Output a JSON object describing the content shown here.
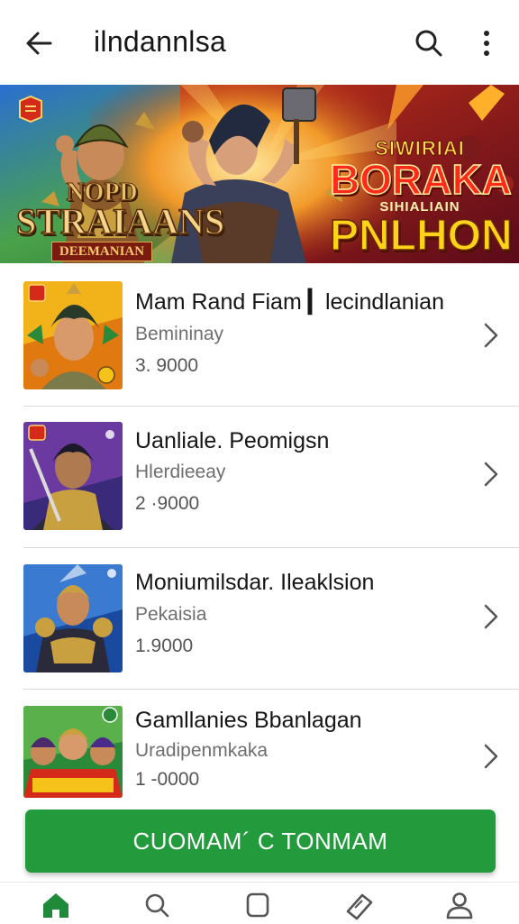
{
  "app_bar": {
    "title": "ilndannlsa",
    "back_icon": "arrow-left-icon",
    "search_icon": "search-icon",
    "more_icon": "more-vertical-icon"
  },
  "banner": {
    "left_title_top": "NOPD",
    "left_title_main": "STRAIAANS",
    "left_ribbon": "DEEMANIAN",
    "right_small_top": "SIWIRIAI",
    "right_title_main": "BORAKA",
    "right_small_mid": "SIHIALIAIN",
    "right_title_bottom": "PNLHON"
  },
  "games": [
    {
      "name": "Mam Rand Fiam ▎lecindlanian",
      "subtitle": "Bemininay",
      "count": "3. 9000",
      "chevron_icon": "chevron-right-icon"
    },
    {
      "name": "Uanliale. Peomigsn",
      "subtitle": "Hlerdieeay",
      "count": "2 ·9000",
      "chevron_icon": "chevron-right-icon"
    },
    {
      "name": "Moniumilsdar. Ileaklsion",
      "subtitle": "Pekaisia",
      "count": "1.9000",
      "chevron_icon": "chevron-right-icon"
    },
    {
      "name": "Gamllanies Bbanlagan",
      "subtitle": "Uradipenmkaka",
      "count": "1 -0000",
      "chevron_icon": "chevron-right-icon"
    }
  ],
  "cta": {
    "label": "CUOMAM´ C TONMAM"
  },
  "bottom_nav": [
    {
      "icon": "home-icon",
      "active": true
    },
    {
      "icon": "search-icon",
      "active": false
    },
    {
      "icon": "square-icon",
      "active": false
    },
    {
      "icon": "ticket-icon",
      "active": false
    },
    {
      "icon": "profile-icon",
      "active": false
    }
  ],
  "colors": {
    "accent_green": "#239a3b",
    "nav_active": "#1f8a3a",
    "nav_inactive": "#555555",
    "subtitle_gray": "#6e6e6e",
    "divider": "#d9d9d9"
  }
}
